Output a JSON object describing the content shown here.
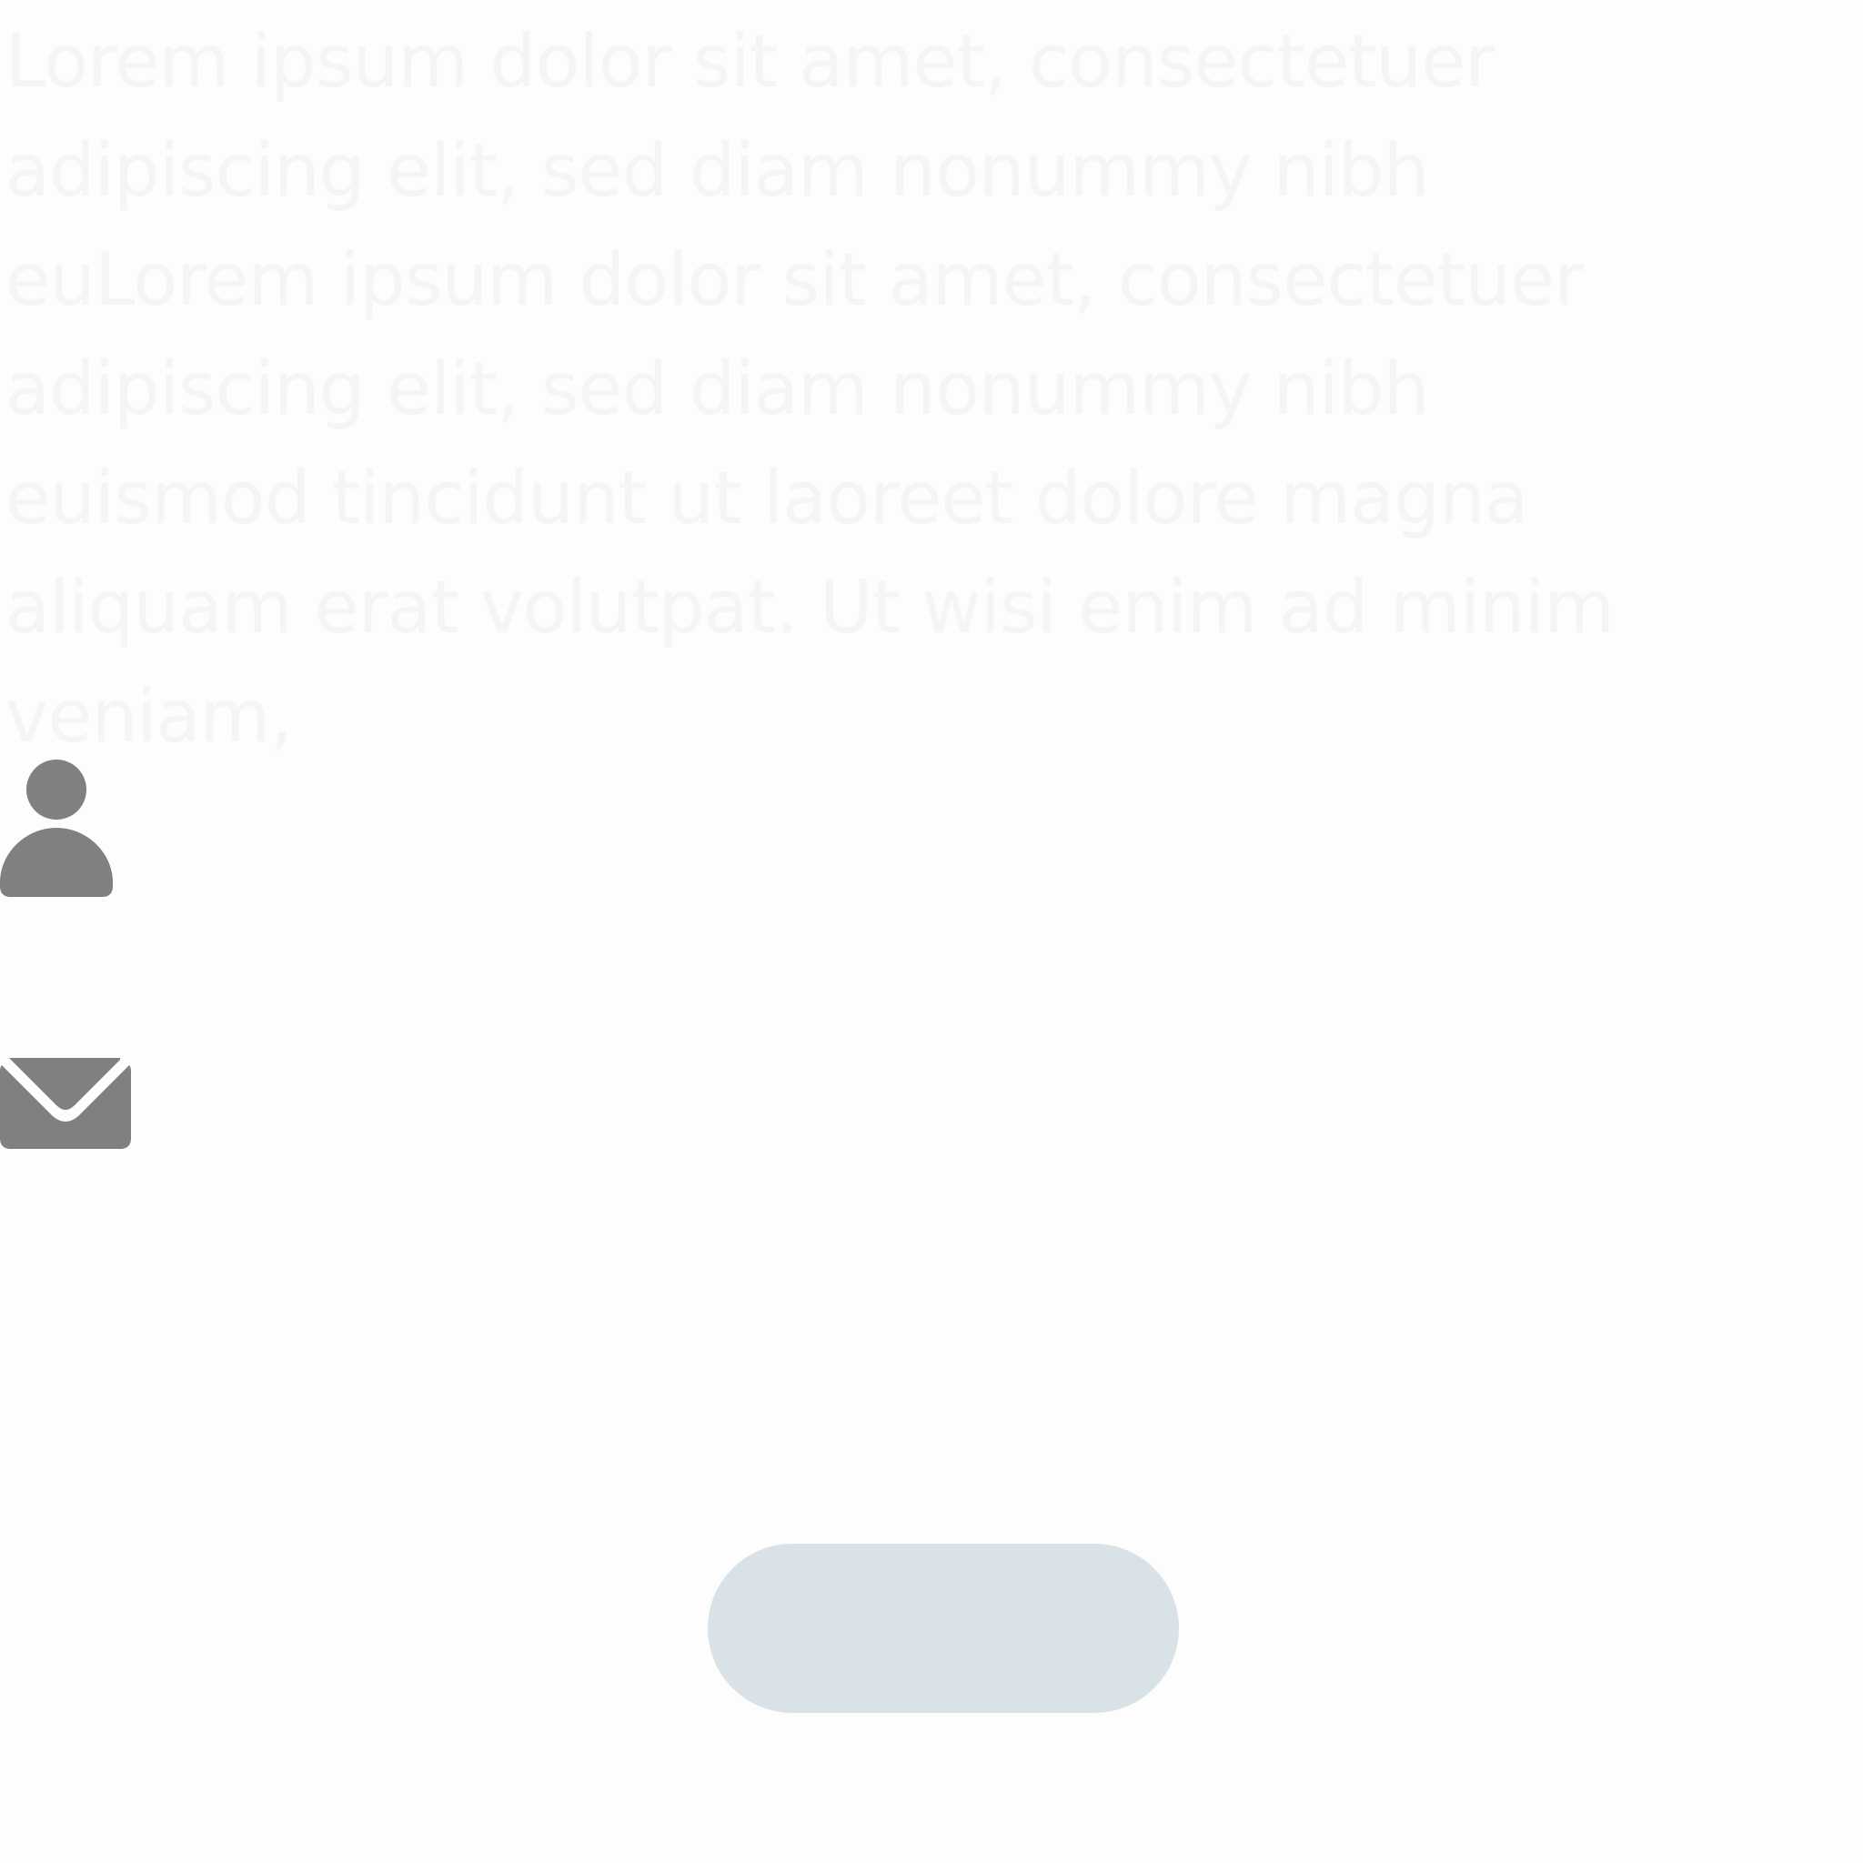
{
  "intro": {
    "text": "Lorem ipsum dolor sit amet, consectetuer adipiscing elit, sed diam nonummy nibh euLorem ipsum dolor sit amet, consectetuer adipiscing elit, sed diam nonummy nibh euismod tincidunt ut laoreet dolore magna aliquam erat volutpat. Ut wisi enim ad minim veniam,"
  },
  "form": {
    "name_field": {
      "icon": "user-icon",
      "value": "",
      "placeholder": ""
    },
    "email_field": {
      "icon": "mail-icon",
      "value": "",
      "placeholder": ""
    },
    "submit": {
      "label": ""
    }
  },
  "colors": {
    "background": "#fdfdfd",
    "faded_text": "#f5f5f5",
    "icon": "#808080",
    "button": "#d9e3e7"
  }
}
